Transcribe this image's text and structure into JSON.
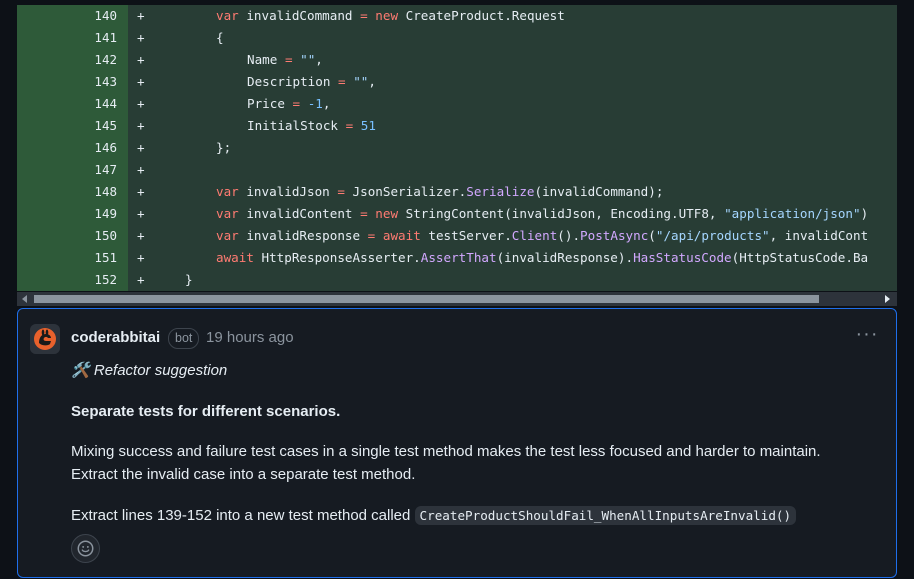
{
  "diff": {
    "rows": [
      {
        "line": "140",
        "marker": "+"
      },
      {
        "line": "141",
        "marker": "+"
      },
      {
        "line": "142",
        "marker": "+"
      },
      {
        "line": "143",
        "marker": "+"
      },
      {
        "line": "144",
        "marker": "+"
      },
      {
        "line": "145",
        "marker": "+"
      },
      {
        "line": "146",
        "marker": "+"
      },
      {
        "line": "147",
        "marker": "+"
      },
      {
        "line": "148",
        "marker": "+"
      },
      {
        "line": "149",
        "marker": "+"
      },
      {
        "line": "150",
        "marker": "+"
      },
      {
        "line": "151",
        "marker": "+"
      },
      {
        "line": "152",
        "marker": "+"
      }
    ],
    "code": {
      "l140": {
        "kw1": "var",
        "id1": "invalidCommand",
        "op": "=",
        "kw2": "new",
        "rest": "CreateProduct.Request"
      },
      "l141": {
        "brace": "{"
      },
      "l142": {
        "name": "Name",
        "op": "=",
        "val": "\"\"",
        "comma": ","
      },
      "l143": {
        "name": "Description",
        "op": "=",
        "val": "\"\"",
        "comma": ","
      },
      "l144": {
        "name": "Price",
        "op": "=",
        "val": "-1",
        "comma": ","
      },
      "l145": {
        "name": "InitialStock",
        "op": "=",
        "val": "51"
      },
      "l146": {
        "brace": "};"
      },
      "l148": {
        "kw1": "var",
        "id1": "invalidJson",
        "op": "=",
        "obj": "JsonSerializer.",
        "fn": "Serialize",
        "args": "(invalidCommand);"
      },
      "l149": {
        "kw1": "var",
        "id1": "invalidContent",
        "op": "=",
        "kw2": "new",
        "fn": "StringContent",
        "args": "(invalidJson, Encoding.UTF8, ",
        "str": "\"application/json\"",
        "tail": ")"
      },
      "l150": {
        "kw1": "var",
        "id1": "invalidResponse",
        "op": "=",
        "kw2": "await",
        "obj": "testServer.",
        "fn": "Client",
        "mid": "().",
        "fn2": "PostAsync",
        "paren": "(",
        "str": "\"/api/products\"",
        "tail": ", invalidCont"
      },
      "l151": {
        "kw1": "await",
        "obj": "HttpResponseAsserter.",
        "fn": "AssertThat",
        "mid": "(invalidResponse).",
        "fn2": "HasStatusCode",
        "tail": "(HttpStatusCode.Ba"
      },
      "l152": {
        "brace": "}"
      }
    }
  },
  "comment": {
    "author": "coderabbitai",
    "badge": "bot",
    "timestamp": "19 hours ago",
    "menu_label": "···",
    "suggestion_emoji": "🛠️",
    "suggestion_text": "Refactor suggestion",
    "heading": "Separate tests for different scenarios.",
    "para1_line1": "Mixing success and failure test cases in a single test method makes the test less focused and harder to maintain.",
    "para1_line2": "Extract the invalid case into a separate test method.",
    "para2_text": "Extract lines 139-152 into a new test method called",
    "para2_code": "CreateProductShouldFail_WhenAllInputsAreInvalid()"
  },
  "colors": {
    "keyword": "#ff7b72",
    "string": "#a5d6ff",
    "number": "#79c0ff",
    "function": "#d2a8ff",
    "addition_line_bg": "#2e5a39",
    "addition_code_bg": "#283d35",
    "comment_border": "#1f6feb"
  },
  "icons": {
    "avatar": "coderabbit-logo",
    "reaction": "smiley-icon",
    "menu": "kebab-horizontal-icon"
  }
}
